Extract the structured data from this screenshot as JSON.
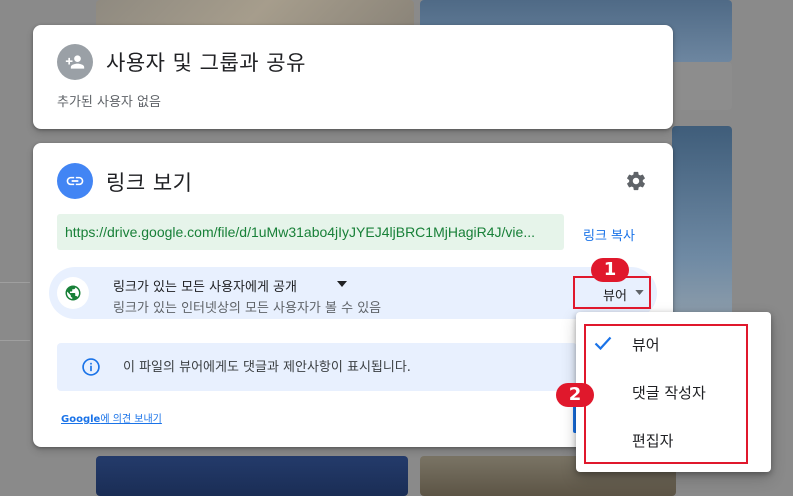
{
  "share_card": {
    "title": "사용자 및 그룹과 공유",
    "subtitle": "추가된 사용자 없음",
    "icon": "person-add-icon"
  },
  "link_card": {
    "title": "링크 보기",
    "icon": "link-icon",
    "settings_icon": "gear-icon",
    "url": "https://drive.google.com/file/d/1uMw31abo4jIyJYEJ4ljBRC1MjHagiR4J/vie...",
    "copy_label": "링크 복사",
    "access": {
      "icon": "globe-icon",
      "title": "링크가 있는 모든 사용자에게 공개",
      "subtitle": "링크가 있는 인터넷상의 모든 사용자가 볼 수 있음",
      "role": "뷰어"
    },
    "info_text": "이 파일의 뷰어에게도 댓글과 제안사항이 표시됩니다.",
    "feedback": {
      "brand": "Google",
      "text": "에 의견 보내기"
    }
  },
  "role_menu": {
    "items": [
      {
        "label": "뷰어",
        "selected": true
      },
      {
        "label": "댓글 작성자",
        "selected": false
      },
      {
        "label": "편집자",
        "selected": false
      }
    ]
  },
  "annotations": {
    "badge_1": "1",
    "badge_2": "2",
    "color": "#e0182c"
  },
  "colors": {
    "accent": "#1a73e8",
    "url_bg": "#e6f4ea",
    "url_text": "#188038",
    "access_bg": "#e8f0fe",
    "globe": "#188038"
  }
}
